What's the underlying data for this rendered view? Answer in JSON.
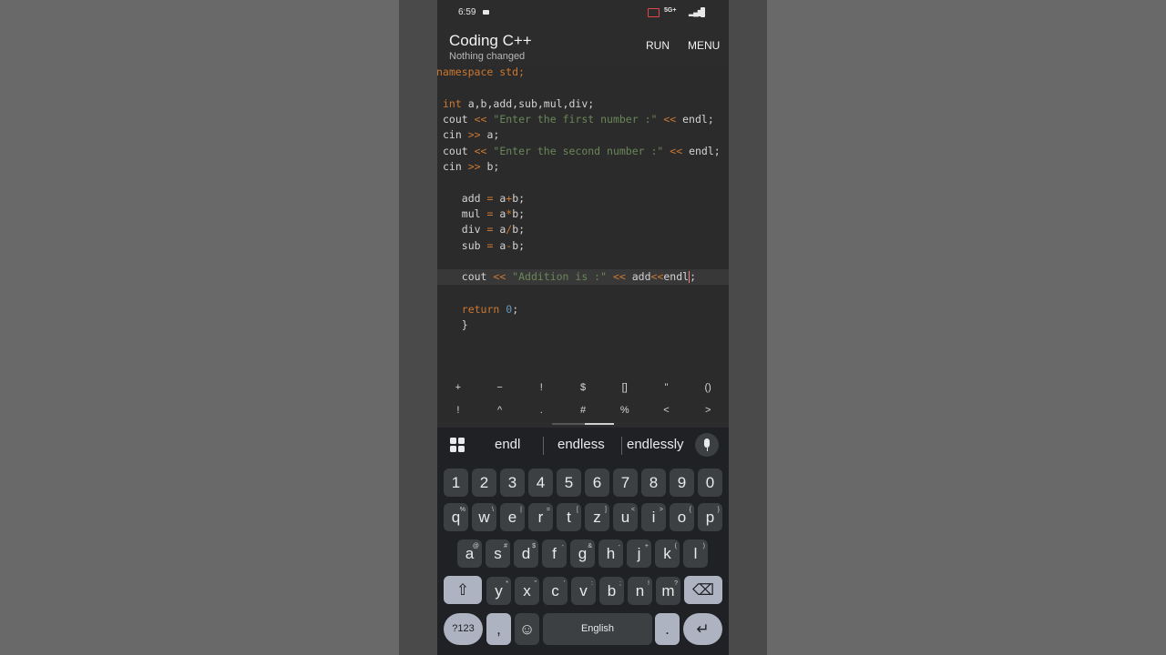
{
  "status": {
    "time": "6:59",
    "network": "5G+"
  },
  "app": {
    "title": "Coding C++",
    "subtitle": "Nothing changed",
    "run": "RUN",
    "menu": "MENU"
  },
  "code": {
    "l1": "namespace std;",
    "l3a": "int",
    "l3b": " a,b,add,sub,mul,div;",
    "l4a": "cout ",
    "l4b": "<<",
    "l4c": " \"Enter the first number :\"",
    "l4d": " << ",
    "l4e": "endl;",
    "l5a": "cin ",
    "l5b": ">>",
    "l5c": " a;",
    "l6a": "cout ",
    "l6b": "<<",
    "l6c": " \"Enter the second number :\"",
    "l6d": " << ",
    "l6e": "endl;",
    "l7a": "cin ",
    "l7b": ">>",
    "l7c": " b;",
    "l9a": "   add ",
    "l9b": "=",
    "l9c": " a",
    "l9d": "+",
    "l9e": "b;",
    "l10a": "   mul ",
    "l10b": "=",
    "l10c": " a",
    "l10d": "*",
    "l10e": "b;",
    "l11a": "   div ",
    "l11b": "=",
    "l11c": " a",
    "l11d": "/",
    "l11e": "b;",
    "l12a": "   sub ",
    "l12b": "=",
    "l12c": " a",
    "l12d": "-",
    "l12e": "b;",
    "l14a": "   cout ",
    "l14b": "<<",
    "l14c": " \"Addition is :\"",
    "l14d": " << ",
    "l14e": "add",
    "l14f": "<<",
    "l14g": "endl",
    "l14h": ";",
    "l16a": "   return ",
    "l16b": "0",
    "l16c": ";",
    "l17": "   }"
  },
  "symbols_row1": [
    "+",
    "−",
    "!",
    "$",
    "[]",
    "''",
    "()"
  ],
  "symbols_row2": [
    "!",
    "^",
    ".",
    "#",
    "%",
    "<",
    ">"
  ],
  "suggestions": [
    "endl",
    "endless",
    "endlessly"
  ],
  "keys": {
    "digits": [
      "1",
      "2",
      "3",
      "4",
      "5",
      "6",
      "7",
      "8",
      "9",
      "0"
    ],
    "row_q": [
      "q",
      "w",
      "e",
      "r",
      "t",
      "z",
      "u",
      "i",
      "o",
      "p"
    ],
    "row_q_alt": [
      "%",
      "\\",
      "|",
      "=",
      "[",
      "]",
      "<",
      ">",
      "{",
      "}"
    ],
    "row_a": [
      "a",
      "s",
      "d",
      "f",
      "g",
      "h",
      "j",
      "k",
      "l"
    ],
    "row_a_alt": [
      "@",
      "#",
      "$",
      "-",
      "&",
      "-",
      "+",
      "(",
      ")"
    ],
    "row_y": [
      "y",
      "x",
      "c",
      "v",
      "b",
      "n",
      "m"
    ],
    "row_y_alt": [
      "*",
      "\"",
      "'",
      ":",
      ";",
      "!",
      "?"
    ],
    "sym": "?123",
    "comma": ",",
    "space": "English",
    "period": "."
  },
  "icons": [
    "apps-grid-icon",
    "mic-icon",
    "shift-icon",
    "backspace-icon",
    "emoji-icon",
    "enter-icon"
  ]
}
